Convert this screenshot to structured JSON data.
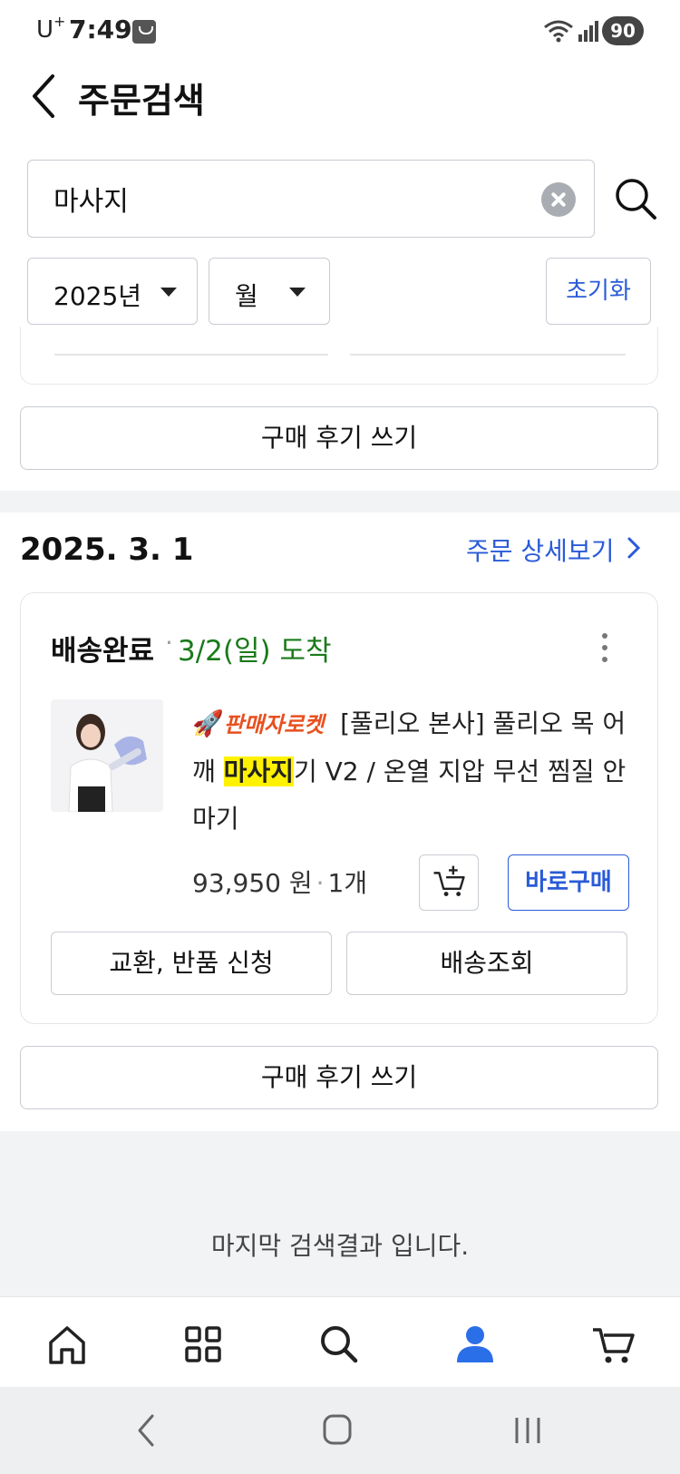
{
  "status_bar": {
    "carrier": "U",
    "carrier_sup": "+",
    "time": "7:49",
    "battery": "90"
  },
  "header": {
    "title": "주문검색"
  },
  "search": {
    "value": "마사지"
  },
  "filters": {
    "year": "2025년",
    "month": "월",
    "reset_label": "초기화"
  },
  "review_button_label": "구매 후기 쓰기",
  "order": {
    "date": "2025. 3. 1",
    "detail_link": "주문 상세보기",
    "delivery_status": "배송완료",
    "separator": "·",
    "arrival": "3/2(일) 도착",
    "seller_badge": "판매자로켓",
    "title_before": "[풀리오 본사] 풀리오 목 어깨 ",
    "title_highlight": "마사지",
    "title_after": "기 V2 / 온열 지압 무선 찜질 안마기",
    "price": "93,950 원",
    "quantity": "1개",
    "buy_now_label": "바로구매",
    "exchange_label": "교환, 반품 신청",
    "tracking_label": "배송조회"
  },
  "end_message": "마지막 검색결과 입니다.",
  "bottom_nav": {
    "items": [
      {
        "icon": "home-icon"
      },
      {
        "icon": "category-grid-icon"
      },
      {
        "icon": "search-icon"
      },
      {
        "icon": "my-page-person-icon",
        "active": true
      },
      {
        "icon": "cart-icon"
      }
    ],
    "active_color": "#2a6ee8",
    "inactive_color": "#222222"
  },
  "colors": {
    "accent": "#2a5bd7",
    "delivered_green": "#1a7a1a",
    "rocket_orange": "#e8501f",
    "highlight_yellow": "#fff200"
  }
}
